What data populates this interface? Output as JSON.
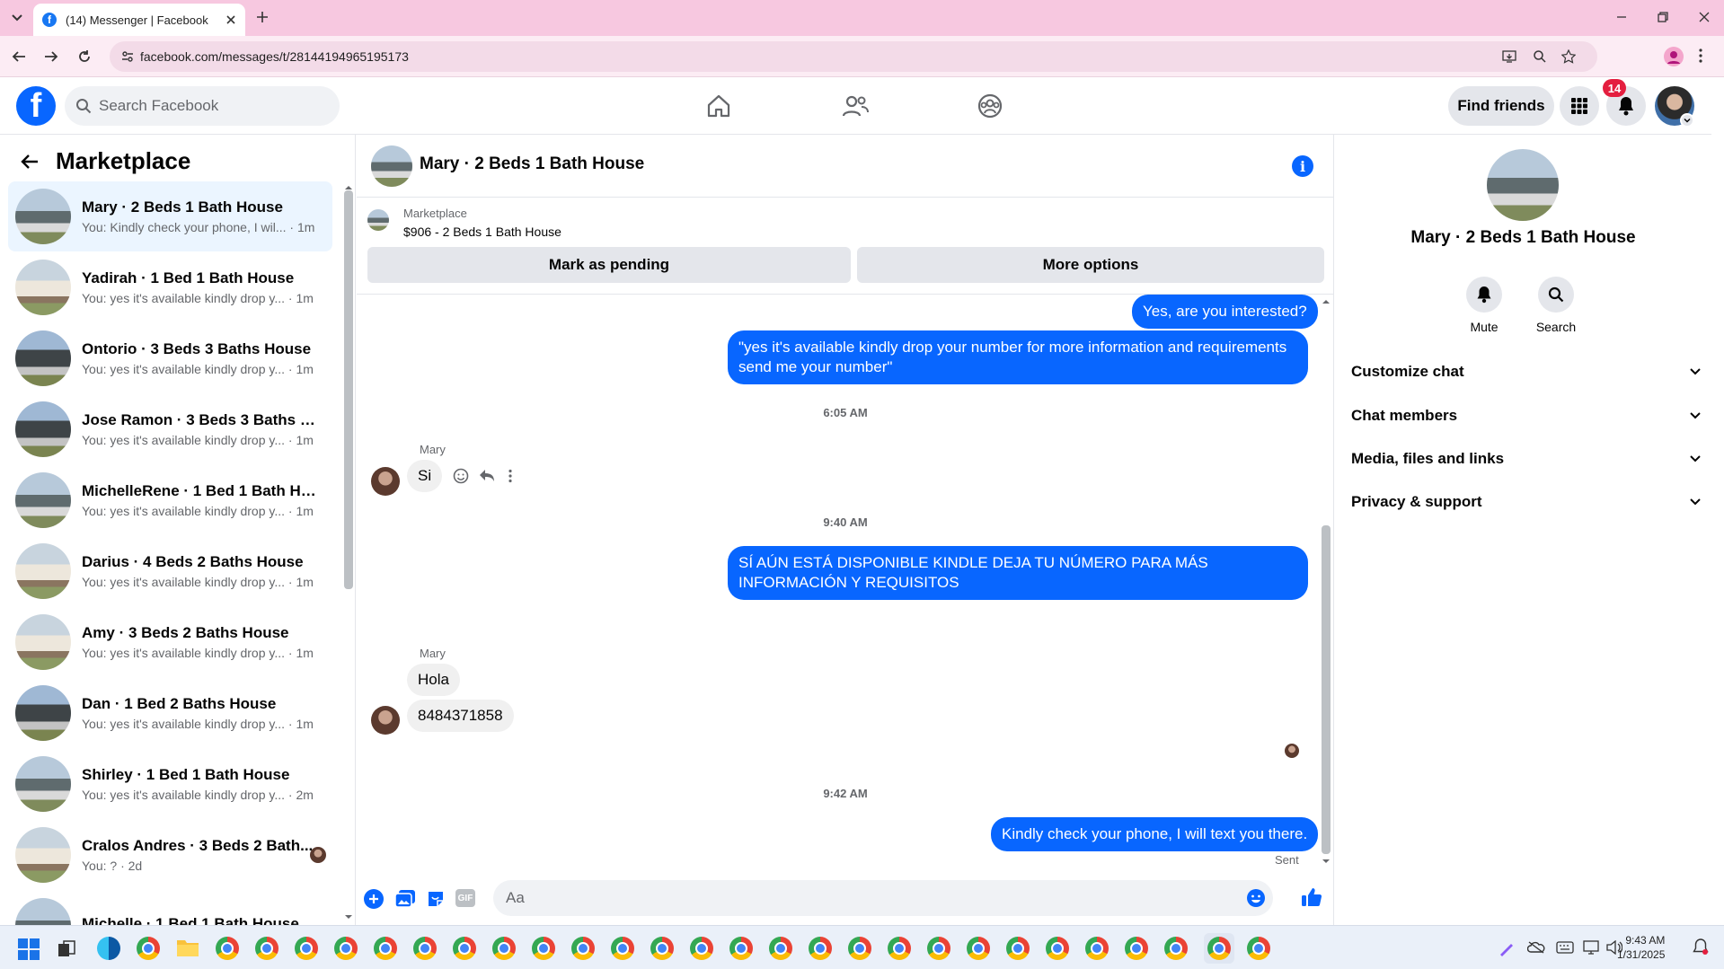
{
  "browser": {
    "tab_title": "(14) Messenger | Facebook",
    "url": "facebook.com/messages/t/28144194965195173"
  },
  "fb_nav": {
    "logo": "f",
    "search_placeholder": "Search Facebook",
    "find_friends_label": "Find friends",
    "notifications_count": "14"
  },
  "sidebar": {
    "title": "Marketplace",
    "conversations": [
      {
        "name": "Mary · 2 Beds 1 Bath House",
        "preview": "You: Kindly check your phone, I wil... · 1m"
      },
      {
        "name": "Yadirah · 1 Bed 1 Bath House",
        "preview": "You: yes it's available kindly drop y... · 1m"
      },
      {
        "name": "Ontorio · 3 Beds 3 Baths House",
        "preview": "You: yes it's available kindly drop y... · 1m"
      },
      {
        "name": "Jose Ramon · 3 Beds 3 Baths Ho...",
        "preview": "You: yes it's available kindly drop y... · 1m"
      },
      {
        "name": "MichelleRene · 1 Bed 1 Bath House",
        "preview": "You: yes it's available kindly drop y... · 1m"
      },
      {
        "name": "Darius · 4 Beds 2 Baths House",
        "preview": "You: yes it's available kindly drop y... · 1m"
      },
      {
        "name": "Amy · 3 Beds 2 Baths House",
        "preview": "You: yes it's available kindly drop y... · 1m"
      },
      {
        "name": "Dan · 1 Bed 2 Baths House",
        "preview": "You: yes it's available kindly drop y... · 1m"
      },
      {
        "name": "Shirley · 1 Bed 1 Bath House",
        "preview": "You: yes it's available kindly drop y... · 2m"
      },
      {
        "name": "Cralos Andres · 3 Beds 2 Bath...",
        "preview": "You: ? · 2d"
      },
      {
        "name": "Michelle · 1 Bed 1 Bath House",
        "preview": ""
      }
    ]
  },
  "chat": {
    "title": "Mary · 2 Beds 1 Bath House",
    "banner_label": "Marketplace",
    "banner_listing": "$906 - 2 Beds 1 Bath House",
    "mark_pending_label": "Mark as pending",
    "more_options_label": "More options",
    "messages": {
      "out1": "Yes, are you interested?",
      "out2": "\"yes it's available kindly drop your number for more information and requirements send me your number\"",
      "ts1": "6:05 AM",
      "sender1": "Mary",
      "in1": "Si",
      "ts2": "9:40 AM",
      "out3": "SÍ AÚN ESTÁ DISPONIBLE KINDLE DEJA TU NÚMERO PARA MÁS INFORMACIÓN Y REQUISITOS",
      "sender2": "Mary",
      "in2": "Hola",
      "in3": "8484371858",
      "ts3": "9:42 AM",
      "out4": "Kindly check your phone, I will text you there.",
      "status": "Sent"
    },
    "composer_placeholder": "Aa",
    "gif_label": "GIF"
  },
  "right_panel": {
    "name": "Mary · 2 Beds 1 Bath House",
    "mute_label": "Mute",
    "search_label": "Search",
    "sections": [
      "Customize chat",
      "Chat members",
      "Media, files and links",
      "Privacy & support"
    ]
  },
  "taskbar": {
    "time": "9:43 AM",
    "date": "1/31/2025"
  },
  "colors": {
    "fb_blue": "#0866ff",
    "tab_bar": "#f7c8e0",
    "badge_red": "#e41e3f"
  }
}
